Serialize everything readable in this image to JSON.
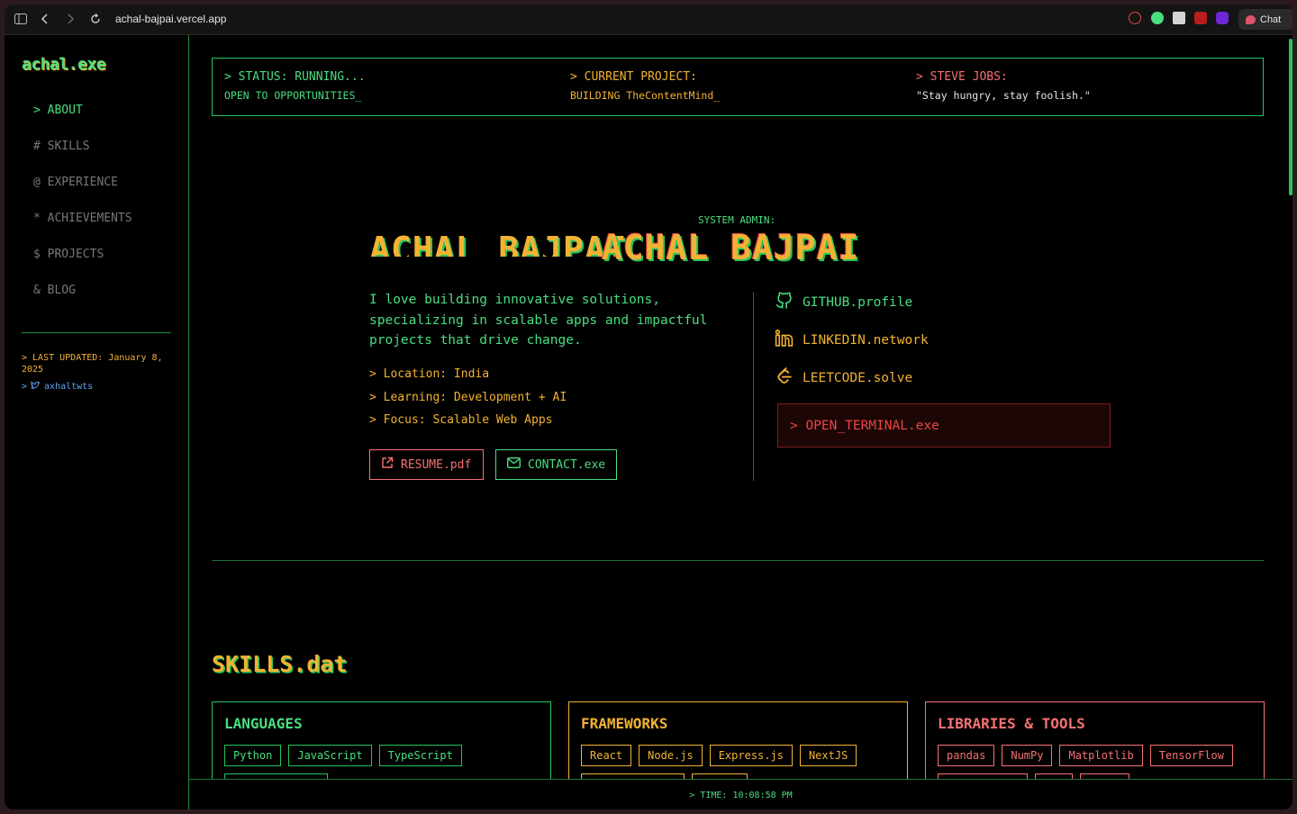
{
  "browser": {
    "url": "achal-bajpai.vercel.app",
    "chat_label": "Chat"
  },
  "sidebar": {
    "logo": "achal.exe",
    "nav": [
      {
        "label": "> ABOUT"
      },
      {
        "label": "# SKILLS"
      },
      {
        "label": "@ EXPERIENCE"
      },
      {
        "label": "* ACHIEVEMENTS"
      },
      {
        "label": "$ PROJECTS"
      },
      {
        "label": "& BLOG"
      }
    ],
    "last_updated": "> LAST UPDATED: January 8, 2025",
    "twitter_prefix": ">",
    "twitter_handle": "axhaltwts"
  },
  "status": {
    "running_title": "> STATUS: RUNNING...",
    "running_value": "OPEN TO OPPORTUNITIES_",
    "project_title": "> CURRENT PROJECT:",
    "project_value": "BUILDING TheContentMind_",
    "quote_title": "> STEVE JOBS:",
    "quote_value": "\"Stay hungry, stay foolish.\""
  },
  "hero": {
    "label": "SYSTEM ADMIN:",
    "name": "ACHAL BAJPAI",
    "intro": "I love building innovative solutions, specializing in scalable apps and impactful projects that drive change.",
    "facts": [
      "> Location: India",
      "> Learning: Development + AI",
      "> Focus: Scalable Web Apps"
    ],
    "resume_label": "RESUME.pdf",
    "contact_label": "CONTACT.exe"
  },
  "links": {
    "github": "GITHUB.profile",
    "linkedin": "LINKEDIN.network",
    "leetcode": "LEETCODE.solve",
    "terminal": "> OPEN_TERMINAL.exe"
  },
  "skills": {
    "title": "SKILLS.dat",
    "languages_title": "LANGUAGES",
    "languages": [
      "Python",
      "JavaScript",
      "TypeScript"
    ],
    "frameworks_title": "FRAMEWORKS",
    "frameworks": [
      "React",
      "Node.js",
      "Express.js",
      "NextJS"
    ],
    "libraries_title": "LIBRARIES & TOOLS",
    "libraries": [
      "pandas",
      "NumPy",
      "Matplotlib",
      "TensorFlow"
    ]
  },
  "footer": {
    "time": "> TIME: 10:08:58 PM"
  },
  "colors": {
    "green": "#4ade80",
    "yellow": "#f2b233",
    "red": "#f87171",
    "background": "#000000"
  }
}
